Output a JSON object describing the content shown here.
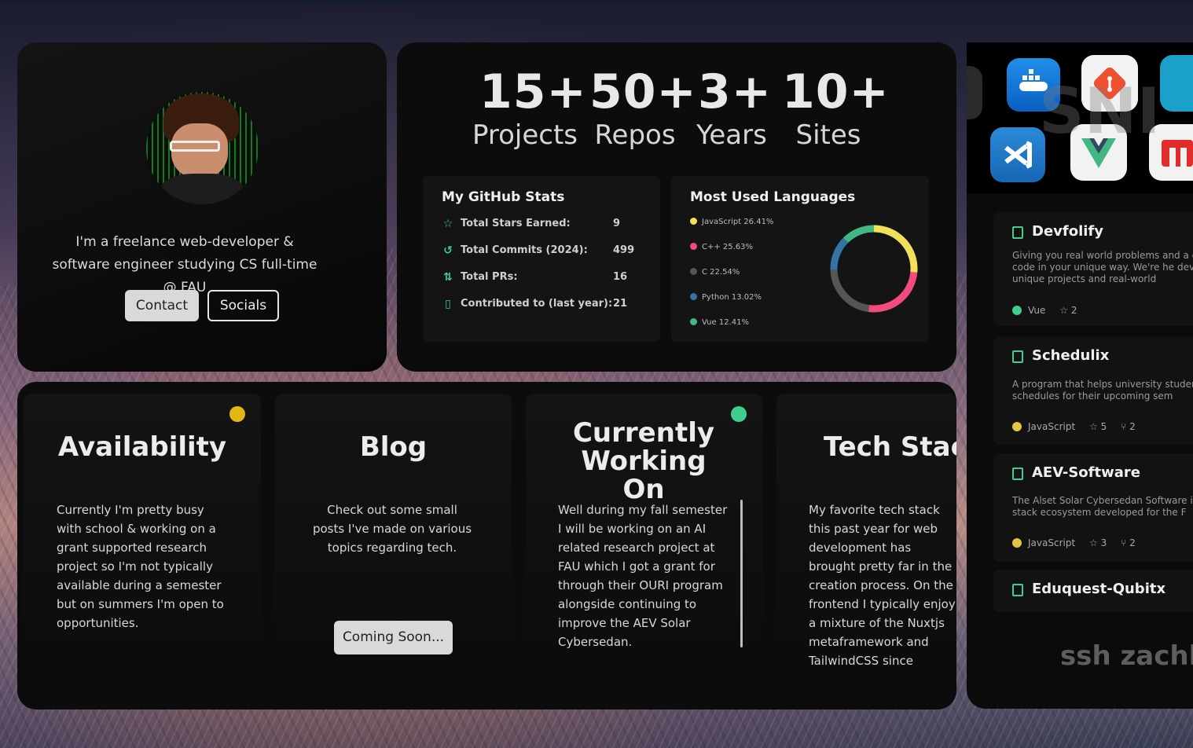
{
  "profile": {
    "bio": "I'm a freelance web-developer & software engineer studying CS full-time @ FAU",
    "contact_label": "Contact",
    "socials_label": "Socials"
  },
  "stats": {
    "items": [
      {
        "value": "15+",
        "label": "Projects"
      },
      {
        "value": "50+",
        "label": "Repos"
      },
      {
        "value": "3+",
        "label": "Years"
      },
      {
        "value": "10+",
        "label": "Sites"
      }
    ]
  },
  "github": {
    "title": "My GitHub Stats",
    "rows": [
      {
        "icon": "star-icon",
        "label": "Total Stars Earned:",
        "value": "9"
      },
      {
        "icon": "history-icon",
        "label": "Total Commits (2024):",
        "value": "499"
      },
      {
        "icon": "pull-request-icon",
        "label": "Total PRs:",
        "value": "16"
      },
      {
        "icon": "repo-icon",
        "label": "Contributed to (last year):",
        "value": "21"
      }
    ]
  },
  "languages": {
    "title": "Most Used Languages",
    "items": [
      {
        "label": "JavaScript 26.41%",
        "name": "JavaScript",
        "pct": 26.41,
        "color": "#f1e05a"
      },
      {
        "label": "C++ 25.63%",
        "name": "C++",
        "pct": 25.63,
        "color": "#f34b7d"
      },
      {
        "label": "C 22.54%",
        "name": "C",
        "pct": 22.54,
        "color": "#555555"
      },
      {
        "label": "Python 13.02%",
        "name": "Python",
        "pct": 13.02,
        "color": "#3572a5"
      },
      {
        "label": "Vue 12.41%",
        "name": "Vue",
        "pct": 12.41,
        "color": "#41b883"
      }
    ]
  },
  "features": {
    "availability": {
      "title": "Availability",
      "status_color": "#e2b714",
      "text": "Currently I'm pretty busy with school & working on a grant supported research project so I'm not typically available during a semester but on summers I'm open to opportunities."
    },
    "blog": {
      "title": "Blog",
      "text": "Check out some small posts I've made on various topics regarding tech.",
      "button": "Coming Soon..."
    },
    "working": {
      "title": "Currently Working On",
      "status_color": "#3ecf8e",
      "text": "Well during my fall semester I will be working on an AI related research project at FAU which I got a grant for through their OURI program alongside continuing to improve the AEV Solar Cybersedan."
    },
    "techstack": {
      "title": "Tech Stack",
      "text": "My favorite tech stack this past year for web development has brought pretty far in the creation process. On the frontend I typically enjoy a mixture of the Nuxtjs metaframework and TailwindCSS since"
    }
  },
  "apps_watermark": "SNI",
  "repos": [
    {
      "name": "Devfolify",
      "desc": "Giving you real world problems and a ch using code in your unique way. We're he develop unique projects and real-world",
      "lang": "Vue",
      "lang_color": "#3ecf8e",
      "stars": "2",
      "forks": ""
    },
    {
      "name": "Schedulix",
      "desc": "A program that helps university students course schedules for their upcoming sem",
      "lang": "JavaScript",
      "lang_color": "#e2c541",
      "stars": "5",
      "forks": "2"
    },
    {
      "name": "AEV-Software",
      "desc": "The Alset Solar Cybersedan Software is a full-stack ecosystem developed for the F",
      "lang": "JavaScript",
      "lang_color": "#e2c541",
      "stars": "3",
      "forks": "2"
    },
    {
      "name": "Eduquest-Qubitx",
      "desc": "",
      "lang": "",
      "lang_color": "",
      "stars": "",
      "forks": ""
    }
  ],
  "ssh_text": "ssh zachl.t"
}
